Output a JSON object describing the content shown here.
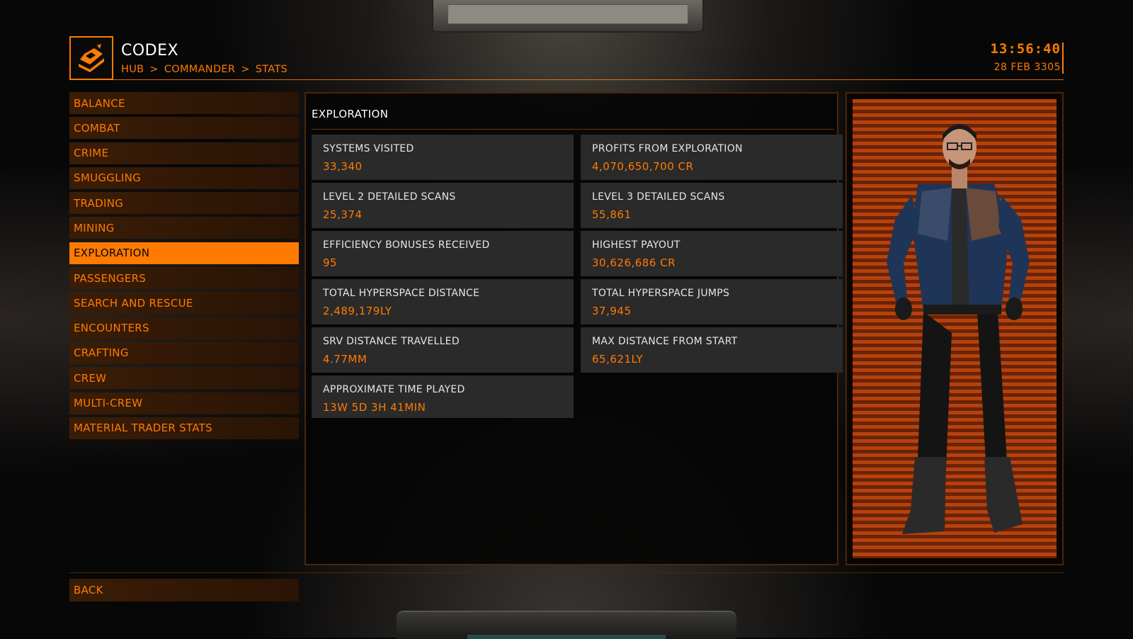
{
  "header": {
    "title": "CODEX",
    "breadcrumb": [
      "HUB",
      "COMMANDER",
      "STATS"
    ],
    "breadcrumb_separator": ">",
    "time": "13:56:40",
    "date": "28 FEB 3305",
    "logo_icon": "codex-book-icon"
  },
  "sidebar": {
    "items": [
      {
        "label": "BALANCE"
      },
      {
        "label": "COMBAT"
      },
      {
        "label": "CRIME"
      },
      {
        "label": "SMUGGLING"
      },
      {
        "label": "TRADING"
      },
      {
        "label": "MINING"
      },
      {
        "label": "EXPLORATION"
      },
      {
        "label": "PASSENGERS"
      },
      {
        "label": "SEARCH AND RESCUE"
      },
      {
        "label": "ENCOUNTERS"
      },
      {
        "label": "CRAFTING"
      },
      {
        "label": "CREW"
      },
      {
        "label": "MULTI-CREW"
      },
      {
        "label": "MATERIAL TRADER STATS"
      }
    ],
    "active_label": "EXPLORATION"
  },
  "main": {
    "section_title": "EXPLORATION",
    "stats": [
      {
        "label": "SYSTEMS VISITED",
        "value": "33,340"
      },
      {
        "label": "PROFITS FROM EXPLORATION",
        "value": "4,070,650,700 CR"
      },
      {
        "label": "LEVEL 2 DETAILED SCANS",
        "value": "25,374"
      },
      {
        "label": "LEVEL 3 DETAILED SCANS",
        "value": "55,861"
      },
      {
        "label": "EFFICIENCY BONUSES RECEIVED",
        "value": "95"
      },
      {
        "label": "HIGHEST PAYOUT",
        "value": "30,626,686 CR"
      },
      {
        "label": "TOTAL HYPERSPACE DISTANCE",
        "value": "2,489,179LY"
      },
      {
        "label": "TOTAL HYPERSPACE JUMPS",
        "value": "37,945"
      },
      {
        "label": "SRV DISTANCE TRAVELLED",
        "value": "4.77MM"
      },
      {
        "label": "MAX DISTANCE FROM START",
        "value": "65,621LY"
      },
      {
        "label": "APPROXIMATE TIME PLAYED",
        "value": "13W 5D 3H 41MIN"
      }
    ]
  },
  "footer": {
    "back_label": "BACK"
  },
  "colors": {
    "accent": "#ff7a00",
    "item_bg": "#3a1d06",
    "stat_bg": "#2a2a2a",
    "label_text": "#e6e6e6"
  }
}
